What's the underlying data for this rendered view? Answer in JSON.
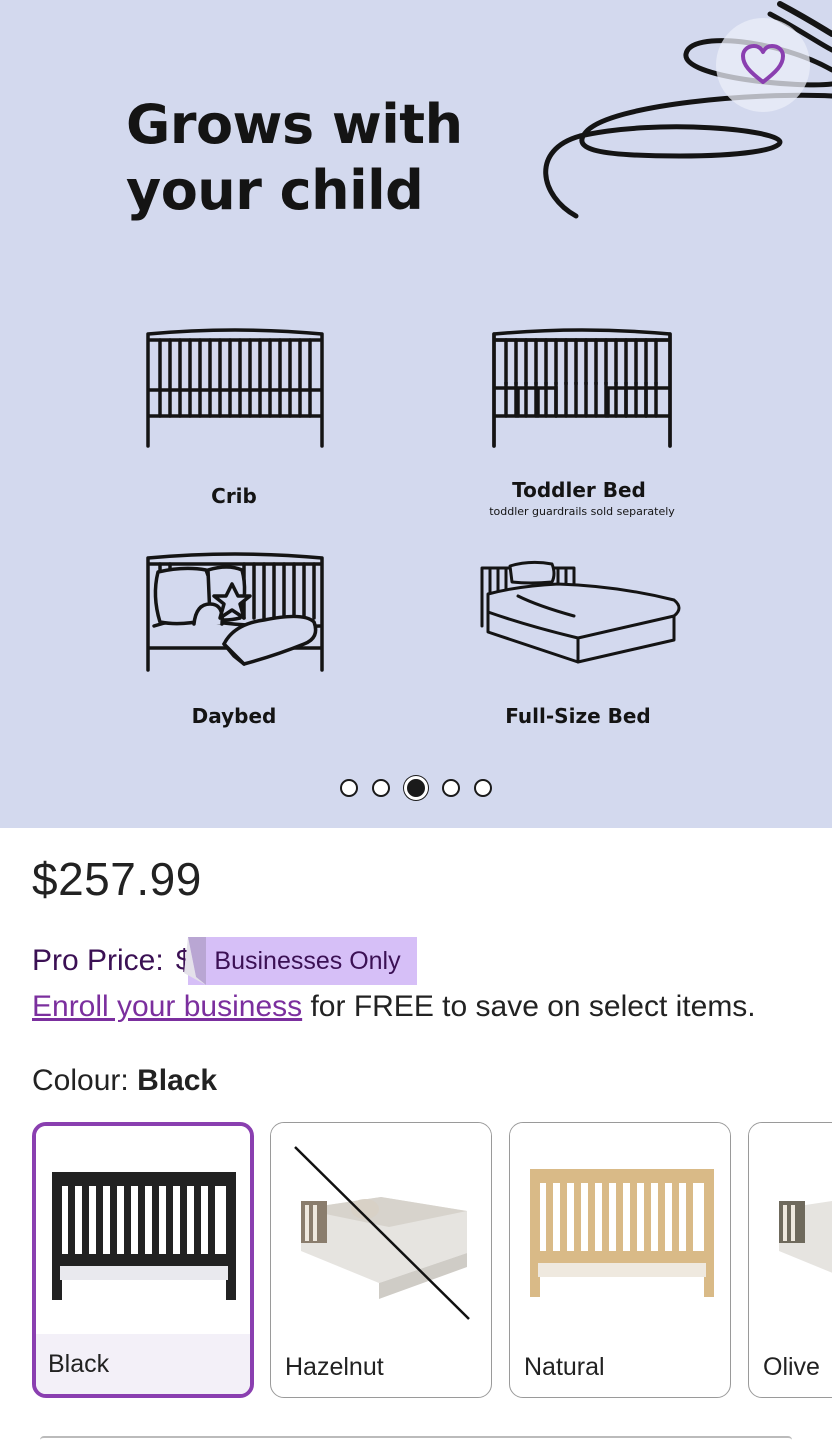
{
  "hero": {
    "title_line1": "Grows with",
    "title_line2": "your child",
    "background": "#d3d9ee",
    "favorite_icon": "heart-icon",
    "stages": [
      {
        "label": "Crib",
        "sublabel": ""
      },
      {
        "label": "Toddler Bed",
        "sublabel": "toddler guardrails sold separately"
      },
      {
        "label": "Daybed",
        "sublabel": ""
      },
      {
        "label": "Full-Size Bed",
        "sublabel": ""
      }
    ],
    "carousel": {
      "total": 5,
      "active_index": 3
    }
  },
  "product": {
    "price": "$257.99",
    "pro_price_label": "Pro Price:",
    "pro_price_value": "$",
    "pro_badge": "Businesses Only",
    "enroll_link": "Enroll your business",
    "enroll_text": " for FREE to save on select items.",
    "colour_label": "Colour:",
    "colour_selected": "Black",
    "colours": [
      {
        "name": "Black",
        "selected": true,
        "available": true
      },
      {
        "name": "Hazelnut",
        "selected": false,
        "available": false
      },
      {
        "name": "Natural",
        "selected": false,
        "available": true
      },
      {
        "name": "Olive",
        "selected": false,
        "available": true
      }
    ]
  },
  "colors": {
    "accent": "#8a3fb0",
    "link": "#7b2f9e",
    "badge_bg": "#d6bff7",
    "pro_text": "#3b1054"
  }
}
